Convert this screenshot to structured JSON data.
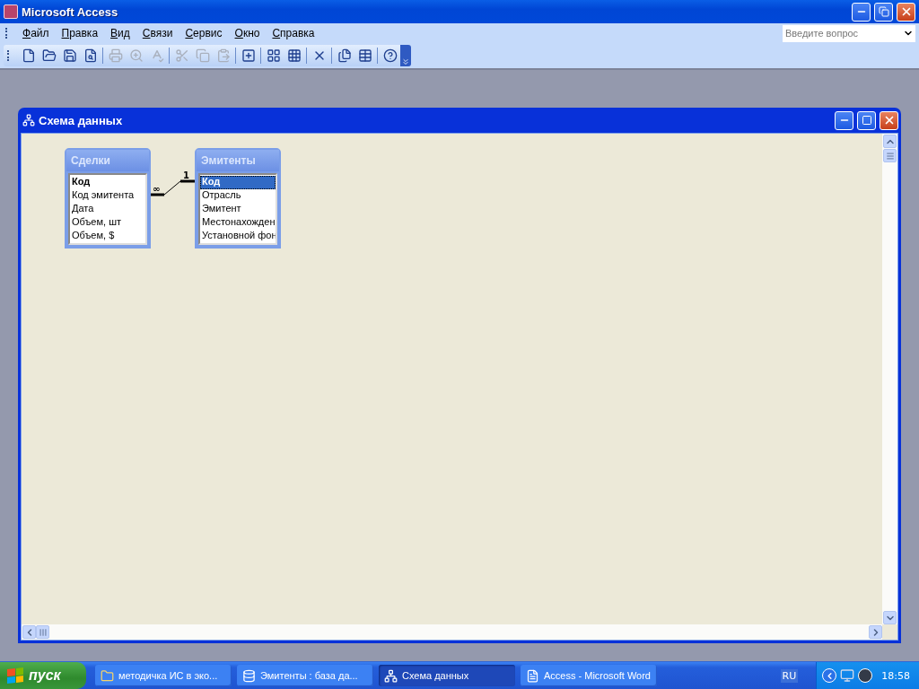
{
  "window": {
    "title": "Microsoft Access"
  },
  "menu": [
    {
      "label": "Файл"
    },
    {
      "label": "Правка"
    },
    {
      "label": "Вид"
    },
    {
      "label": "Связи"
    },
    {
      "label": "Сервис"
    },
    {
      "label": "Окно"
    },
    {
      "label": "Справка"
    }
  ],
  "help_search": {
    "placeholder": "Введите вопрос"
  },
  "toolbar": [
    [
      {
        "disabled": false
      },
      {
        "disabled": false
      },
      {
        "disabled": false
      },
      {
        "disabled": false
      }
    ],
    [
      {
        "disabled": true
      },
      {
        "disabled": true
      },
      {
        "disabled": true
      }
    ],
    [
      {
        "disabled": true
      },
      {
        "disabled": true
      },
      {
        "disabled": true
      }
    ],
    [
      {
        "disabled": false
      }
    ],
    [
      {
        "disabled": false
      },
      {
        "disabled": false
      }
    ],
    [
      {
        "disabled": false
      }
    ],
    [
      {
        "disabled": false
      },
      {
        "disabled": false
      }
    ],
    [
      {
        "disabled": false
      }
    ]
  ],
  "diagram_window": {
    "title": "Схема данных",
    "tables": [
      {
        "title": "Сделки",
        "fields": [
          {
            "name": "Код",
            "key": true,
            "selected": false
          },
          {
            "name": "Код эмитента",
            "key": false,
            "selected": false
          },
          {
            "name": "Дата",
            "key": false,
            "selected": false
          },
          {
            "name": "Объем, шт",
            "key": false,
            "selected": false
          },
          {
            "name": "Объем, $",
            "key": false,
            "selected": false
          }
        ]
      },
      {
        "title": "Эмитенты",
        "fields": [
          {
            "name": "Код",
            "key": true,
            "selected": true
          },
          {
            "name": "Отрасль",
            "key": false,
            "selected": false
          },
          {
            "name": "Эмитент",
            "key": false,
            "selected": false
          },
          {
            "name": "Местонахожден",
            "key": false,
            "selected": false
          },
          {
            "name": "Установной фон",
            "key": false,
            "selected": false
          }
        ]
      }
    ],
    "relationship": {
      "many_label": "∞",
      "one_label": "1"
    }
  },
  "taskbar": {
    "start": "пуск",
    "tasks": [
      {
        "kind": "folder",
        "label": "методичка ИС в эко...",
        "selected": false
      },
      {
        "kind": "database",
        "label": "Эмитенты : база да...",
        "selected": false
      },
      {
        "kind": "diagram",
        "label": "Схема данных",
        "selected": true
      },
      {
        "kind": "word",
        "label": "Access - Microsoft Word",
        "selected": false
      }
    ],
    "language": "RU",
    "time": "18:58"
  }
}
